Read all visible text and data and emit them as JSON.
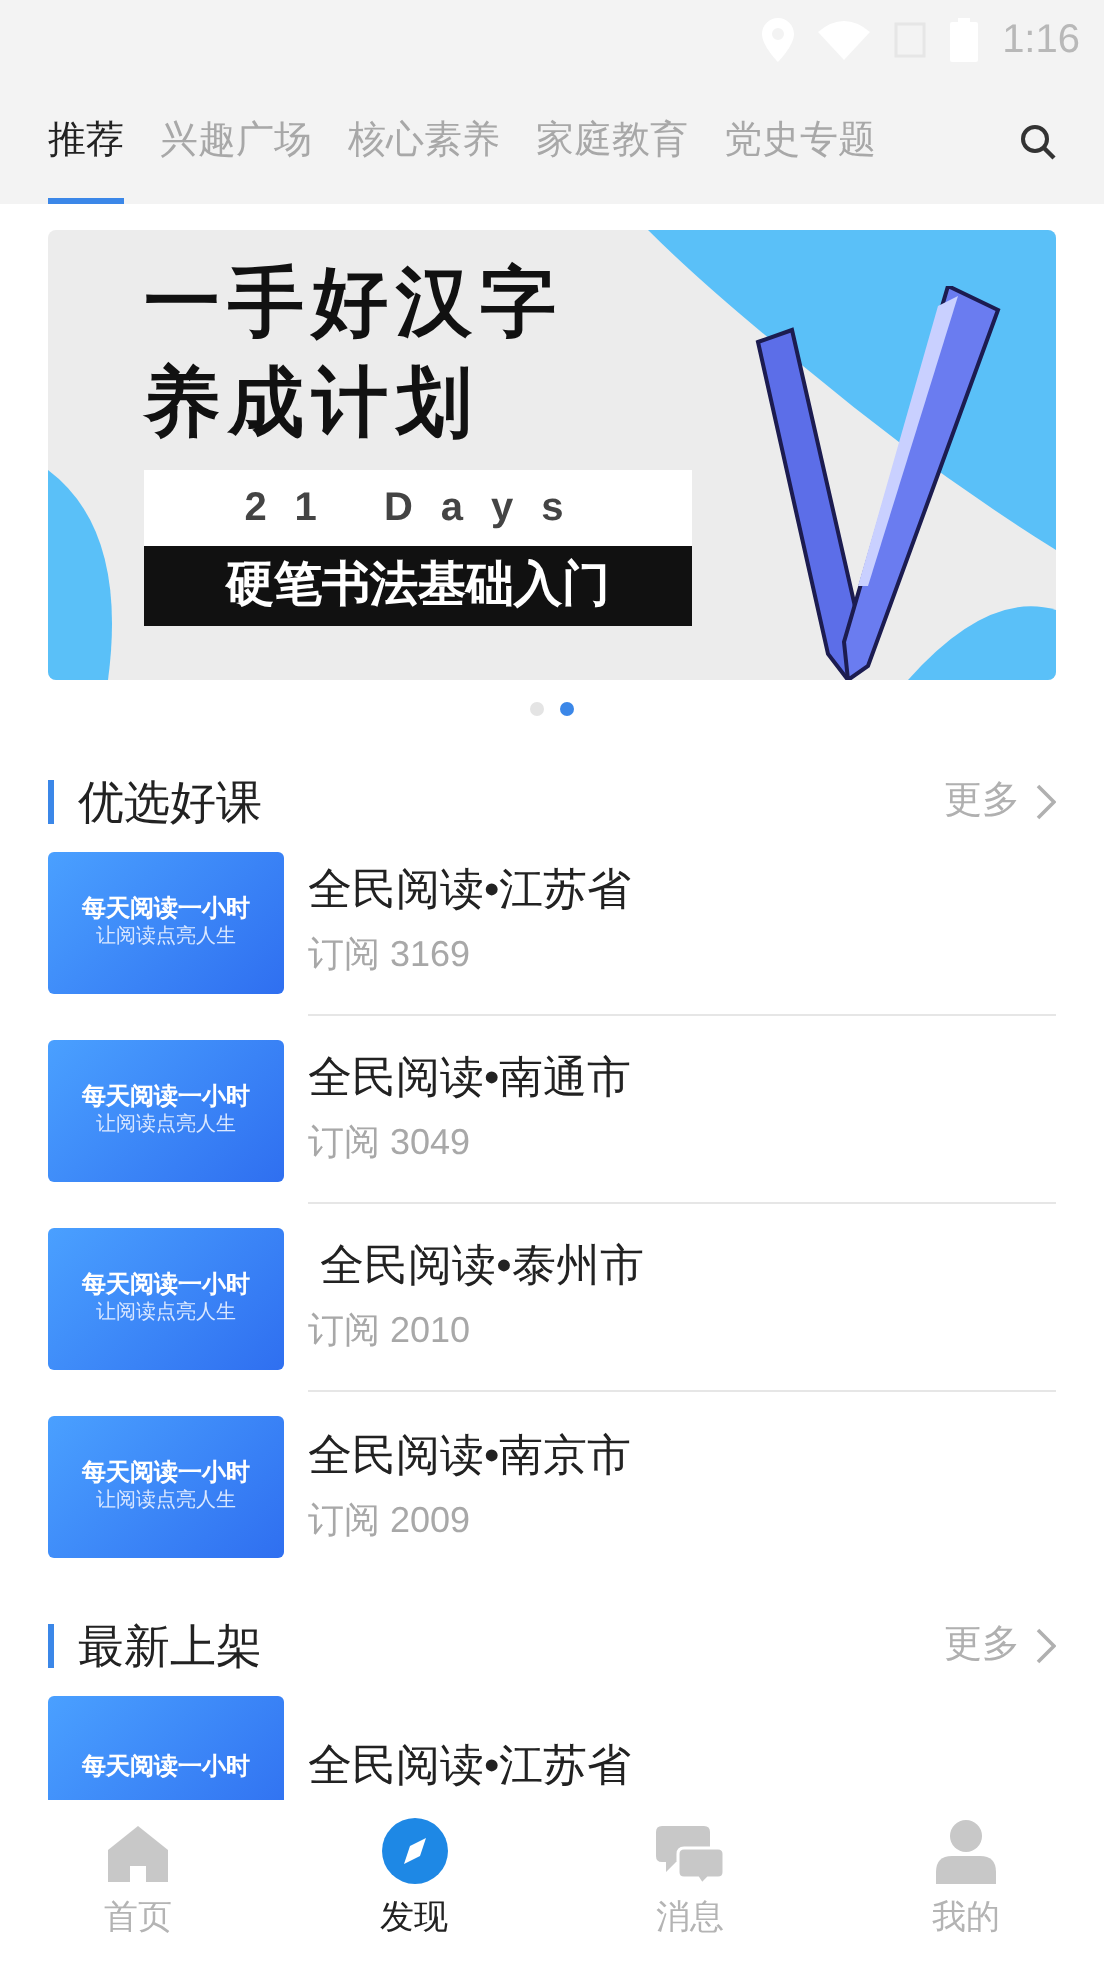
{
  "status_bar": {
    "time": "1:16"
  },
  "tabs": [
    {
      "label": "推荐",
      "selected": true
    },
    {
      "label": "兴趣广场",
      "selected": false
    },
    {
      "label": "核心素养",
      "selected": false
    },
    {
      "label": "家庭教育",
      "selected": false
    },
    {
      "label": "党史专题",
      "selected": false
    }
  ],
  "banner": {
    "title_lines": [
      "一手好汉字",
      "养成计划"
    ],
    "days": "21 Days",
    "subtitle": "硬笔书法基础入门",
    "dots": [
      {
        "selected": false
      },
      {
        "selected": true
      }
    ]
  },
  "sections": [
    {
      "title": "优选好课",
      "more": "更多",
      "courses": [
        {
          "thumb_title": "每天阅读一小时",
          "thumb_subtitle": "让阅读点亮人生",
          "title": "全民阅读•江苏省",
          "subscriptions": "订阅 3169"
        },
        {
          "thumb_title": "每天阅读一小时",
          "thumb_subtitle": "让阅读点亮人生",
          "title": "全民阅读•南通市",
          "subscriptions": "订阅 3049"
        },
        {
          "thumb_title": "每天阅读一小时",
          "thumb_subtitle": "让阅读点亮人生",
          "title": " 全民阅读•泰州市",
          "subscriptions": "订阅 2010"
        },
        {
          "thumb_title": "每天阅读一小时",
          "thumb_subtitle": "让阅读点亮人生",
          "title": "全民阅读•南京市",
          "subscriptions": "订阅 2009"
        }
      ]
    },
    {
      "title": "最新上架",
      "more": "更多",
      "courses": [
        {
          "thumb_title": "每天阅读一小时",
          "title": "全民阅读•江苏省"
        }
      ]
    }
  ],
  "bottom_nav": [
    {
      "label": "首页",
      "kind": "home",
      "selected": false
    },
    {
      "label": "发现",
      "kind": "discover",
      "selected": true
    },
    {
      "label": "消息",
      "kind": "messages",
      "selected": false
    },
    {
      "label": "我的",
      "kind": "profile",
      "selected": false
    }
  ]
}
